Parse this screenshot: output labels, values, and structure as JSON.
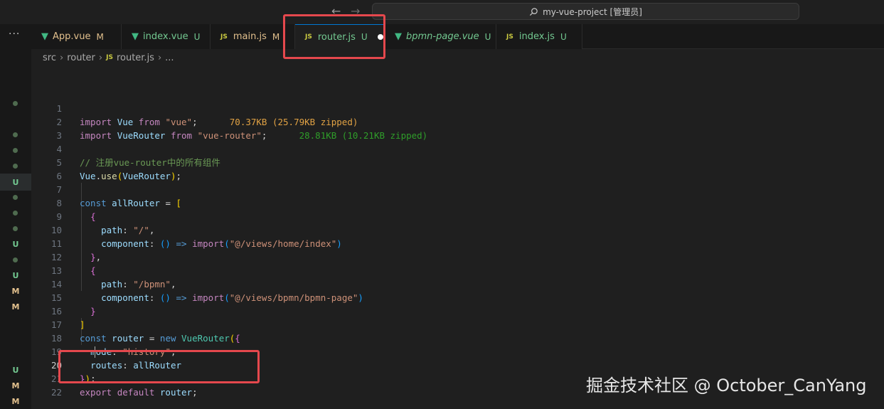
{
  "titlebar": {
    "back_icon": "←",
    "forward_icon": "→",
    "search_text": "my-vue-project [管理员]"
  },
  "activity": {
    "more_label": "···",
    "markers": [
      "U",
      "U",
      "U",
      "M",
      "M",
      "U",
      "M",
      "M"
    ]
  },
  "tabs": [
    {
      "icon": "vue-icon",
      "label": "App.vue",
      "badge": "M"
    },
    {
      "icon": "vue-icon",
      "label": "index.vue",
      "badge": "U"
    },
    {
      "icon": "js-icon",
      "label": "main.js",
      "badge": "M"
    },
    {
      "icon": "js-icon",
      "label": "router.js",
      "badge": "U"
    },
    {
      "icon": "vue-icon",
      "label": "bpmn-page.vue",
      "badge": "U"
    },
    {
      "icon": "js-icon",
      "label": "index.js",
      "badge": "U"
    }
  ],
  "breadcrumb": {
    "parts": [
      "src",
      "router",
      "router.js",
      "..."
    ]
  },
  "js_badge": "JS",
  "vue_badge": "▼",
  "editor": {
    "line_numbers": [
      "1",
      "2",
      "3",
      "4",
      "5",
      "6",
      "7",
      "8",
      "9",
      "10",
      "11",
      "12",
      "13",
      "14",
      "15",
      "16",
      "17",
      "18",
      "19",
      "20",
      "21",
      "22"
    ],
    "current_line": "20",
    "import_cost_vue": "70.37KB (25.79KB zipped)",
    "import_cost_router": "28.81KB (10.21KB zipped)",
    "comment": "// 注册vue-router中的所有组件"
  },
  "watermark": "掘金技术社区 @ October_CanYang"
}
